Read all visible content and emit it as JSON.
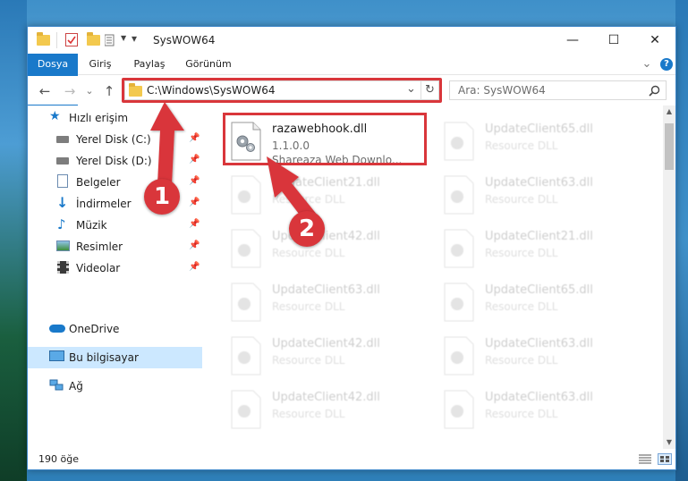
{
  "window": {
    "title": "SysWOW64",
    "minimize_label": "—",
    "maximize_label": "☐",
    "close_label": "✕"
  },
  "ribbon": {
    "tabs": [
      "Dosya",
      "Giriş",
      "Paylaş",
      "Görünüm"
    ],
    "collapse_label": "⌄",
    "help_label": "?"
  },
  "nav": {
    "back_label": "←",
    "forward_label": "→",
    "dropdown_label": "⌄",
    "up_label": "↑",
    "address": "C:\\Windows\\SysWOW64",
    "address_dropdown": "⌄",
    "refresh_label": "↻",
    "search_placeholder": "Ara: SysWOW64"
  },
  "sidebar": {
    "items": [
      {
        "label": "Hızlı erişim",
        "icon": "star-icon",
        "pinned": false
      },
      {
        "label": "Yerel Disk (C:)",
        "icon": "drive-icon",
        "pinned": true
      },
      {
        "label": "Yerel Disk (D:)",
        "icon": "drive-icon",
        "pinned": true
      },
      {
        "label": "Belgeler",
        "icon": "documents-icon",
        "pinned": true
      },
      {
        "label": "İndirmeler",
        "icon": "download-icon",
        "pinned": true
      },
      {
        "label": "Müzik",
        "icon": "music-icon",
        "pinned": true
      },
      {
        "label": "Resimler",
        "icon": "pictures-icon",
        "pinned": true
      },
      {
        "label": "Videolar",
        "icon": "video-icon",
        "pinned": true
      },
      {
        "label": "OneDrive",
        "icon": "cloud-icon",
        "pinned": false
      },
      {
        "label": "Bu bilgisayar",
        "icon": "computer-icon",
        "pinned": false
      },
      {
        "label": "Ağ",
        "icon": "network-icon",
        "pinned": false
      }
    ],
    "pin_glyph": "📌"
  },
  "files": {
    "highlighted": {
      "name": "razawebhook.dll",
      "version": "1.1.0.0",
      "description": "Shareaza Web Downlo..."
    },
    "left_column": [
      {
        "name": "UpdateClient21.dll",
        "description": "Resource DLL"
      },
      {
        "name": "UpdateClient42.dll",
        "description": "Resource DLL"
      },
      {
        "name": "UpdateClient63.dll",
        "description": "Resource DLL"
      },
      {
        "name": "UpdateClient42.dll",
        "description": "Resource DLL"
      },
      {
        "name": "UpdateClient42.dll",
        "description": "Resource DLL"
      }
    ],
    "right_column": [
      {
        "name": "UpdateClient65.dll",
        "description": "Resource DLL"
      },
      {
        "name": "UpdateClient63.dll",
        "description": "Resource DLL"
      },
      {
        "name": "UpdateClient21.dll",
        "description": "Resource DLL"
      },
      {
        "name": "UpdateClient65.dll",
        "description": "Resource DLL"
      },
      {
        "name": "UpdateClient63.dll",
        "description": "Resource DLL"
      },
      {
        "name": "UpdateClient63.dll",
        "description": "Resource DLL"
      }
    ]
  },
  "status": {
    "item_count": "190 öğe"
  },
  "annotations": {
    "badge_1": "1",
    "badge_2": "2",
    "color": "#d9363b"
  }
}
